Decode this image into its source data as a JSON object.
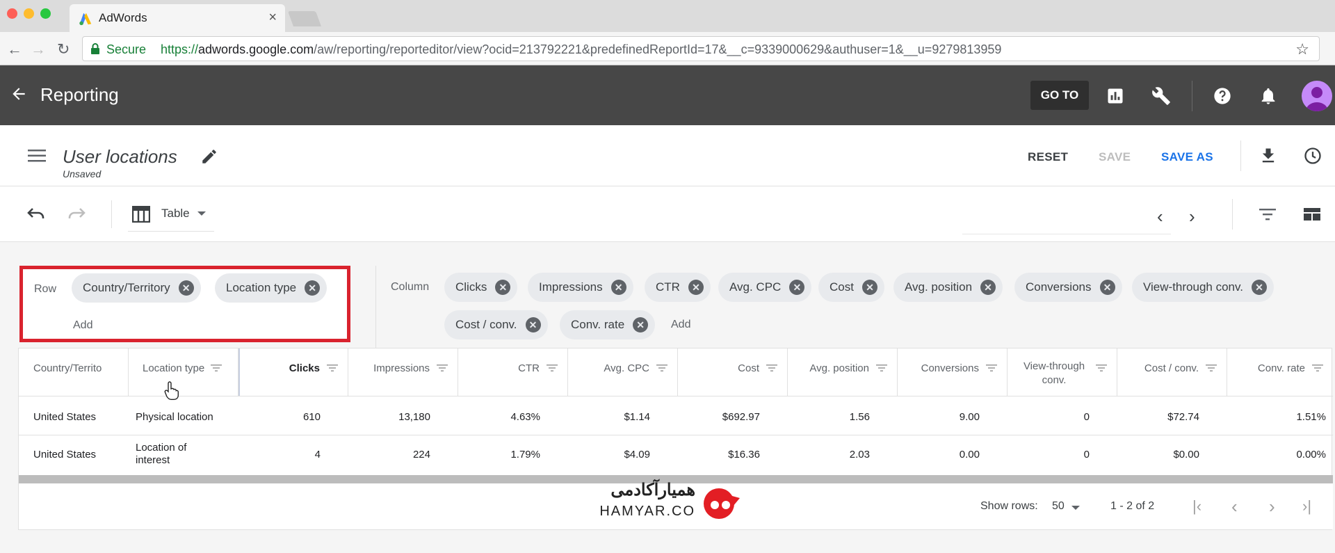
{
  "browser": {
    "tab_title": "AdWords",
    "tab_close": "×",
    "secure_label": "Secure",
    "url_proto": "https://",
    "url_host": "adwords.google.com",
    "url_path": "/aw/reporting/reporteditor/view?ocid=213792221&predefinedReportId=17&__c=9339000629&authuser=1&__u=9279813959",
    "traffic_colors": [
      "#fe5f57",
      "#febc2e",
      "#28c840"
    ]
  },
  "appbar": {
    "title": "Reporting",
    "goto_label": "GO TO",
    "icons": [
      "back-arrow-icon",
      "reports-icon",
      "tools-wrench-icon",
      "help-icon",
      "notifications-bell-icon",
      "avatar"
    ]
  },
  "report": {
    "title": "User locations",
    "status": "Unsaved",
    "reset_label": "RESET",
    "save_label": "SAVE",
    "save_as_label": "SAVE AS"
  },
  "toolbar": {
    "view_label": "Table",
    "prev": "‹",
    "next": "›"
  },
  "row_panel": {
    "label": "Row",
    "chips": [
      "Country/Territory",
      "Location type"
    ],
    "add_label": "Add"
  },
  "column_panel": {
    "label": "Column",
    "chips": [
      "Clicks",
      "Impressions",
      "CTR",
      "Avg. CPC",
      "Cost",
      "Avg. position",
      "Conversions",
      "View-through conv.",
      "Cost / conv.",
      "Conv. rate"
    ],
    "add_label": "Add"
  },
  "table": {
    "headers": [
      "Country/Territo",
      "Location type",
      "Clicks",
      "Impressions",
      "CTR",
      "Avg. CPC",
      "Cost",
      "Avg. position",
      "Conversions",
      "View-through conv.",
      "Cost / conv.",
      "Conv. rate"
    ],
    "rows": [
      [
        "United States",
        "Physical location",
        "610",
        "13,180",
        "4.63%",
        "$1.14",
        "$692.97",
        "1.56",
        "9.00",
        "0",
        "$72.74",
        "1.51%"
      ],
      [
        "United States",
        "Location of interest",
        "4",
        "224",
        "1.79%",
        "$4.09",
        "$16.36",
        "2.03",
        "0.00",
        "0",
        "$0.00",
        "0.00%"
      ]
    ]
  },
  "footer": {
    "show_rows_label": "Show rows:",
    "show_rows_value": "50",
    "range": "1 - 2 of 2"
  },
  "watermark": {
    "fa": "همیارآکادمی",
    "en": "HAMYAR.CO"
  },
  "colors": {
    "appbar": "#474747",
    "accent": "#1a73e8",
    "highlight": "#d9232e"
  }
}
